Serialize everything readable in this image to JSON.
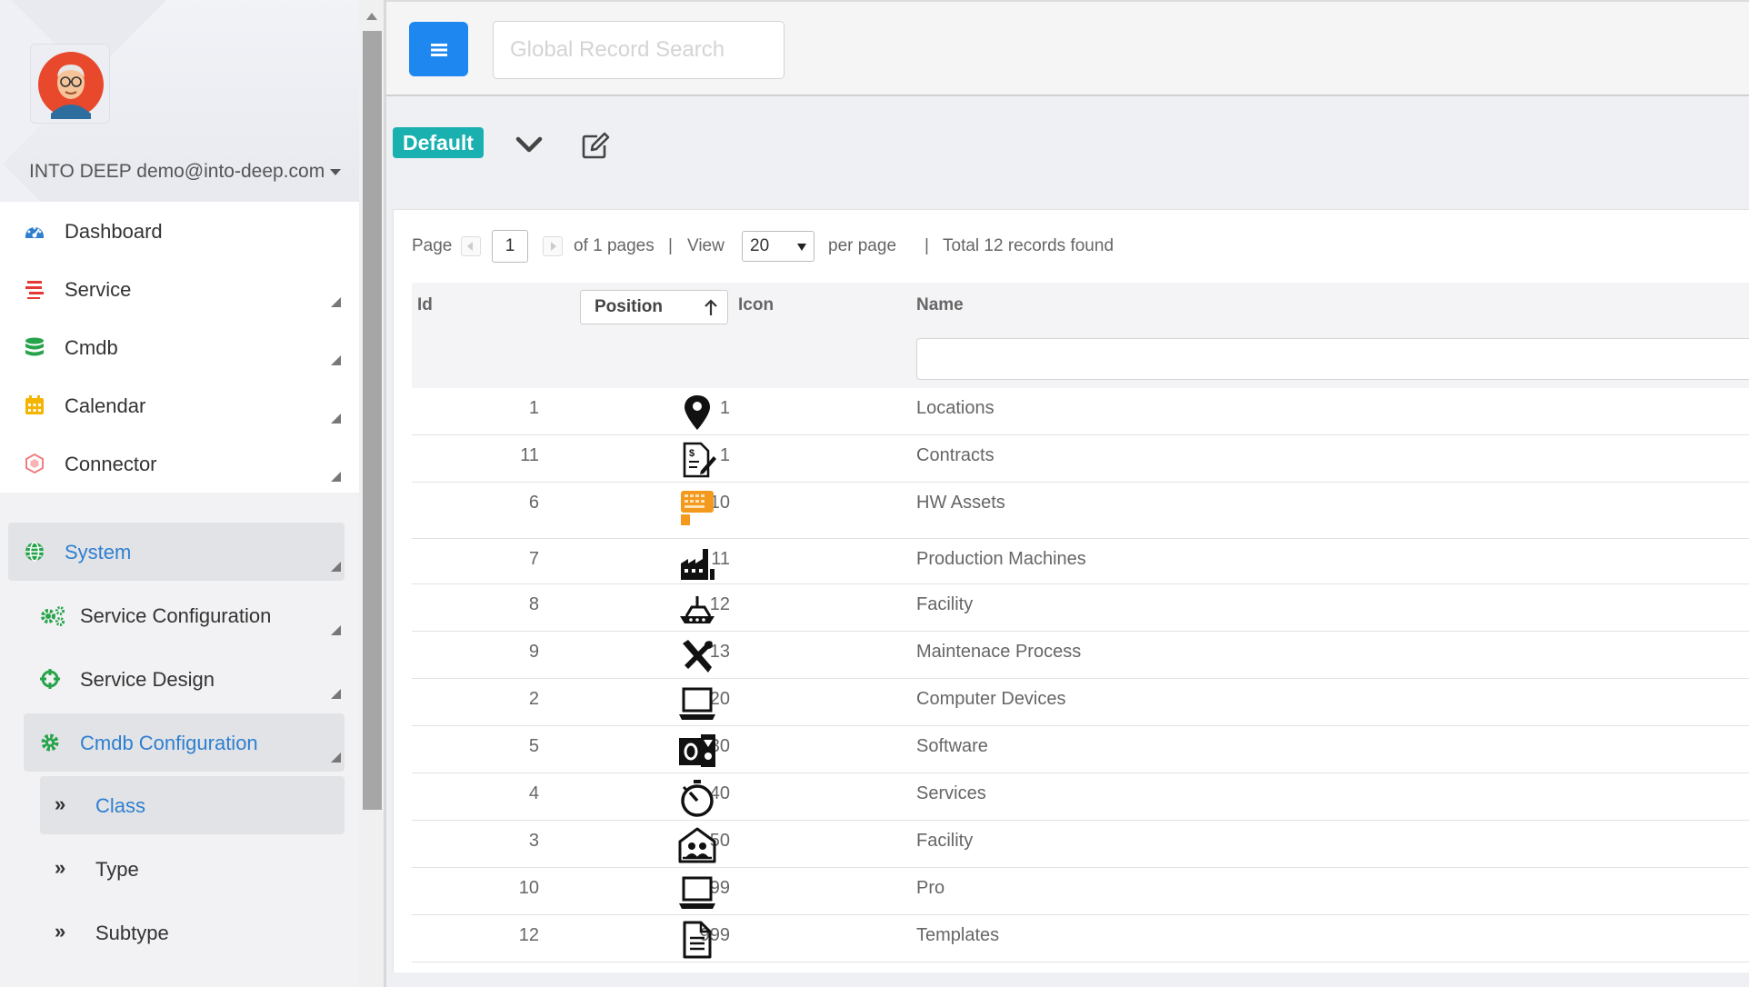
{
  "user": {
    "label": "INTO DEEP demo@into-deep.com"
  },
  "sidebar": {
    "main": [
      {
        "label": "Dashboard",
        "icon": "dashboard-icon",
        "color": "#2e7fd0"
      },
      {
        "label": "Service",
        "icon": "service-list-icon",
        "color": "#e53935"
      },
      {
        "label": "Cmdb",
        "icon": "database-icon",
        "color": "#27a44b"
      },
      {
        "label": "Calendar",
        "icon": "calendar-icon",
        "color": "#f5b400"
      },
      {
        "label": "Connector",
        "icon": "connector-icon",
        "color": "#f08080"
      }
    ],
    "system": {
      "label": "System",
      "icon": "globe-icon"
    },
    "system_items": [
      {
        "label": "Service Configuration",
        "icon": "cogs-icon"
      },
      {
        "label": "Service Design",
        "icon": "crosshair-icon"
      },
      {
        "label": "Cmdb Configuration",
        "icon": "gear-icon"
      }
    ],
    "cmdb_items": [
      {
        "label": "Class"
      },
      {
        "label": "Type"
      },
      {
        "label": "Subtype"
      }
    ]
  },
  "topbar": {
    "search_placeholder": "Global Record Search"
  },
  "view": {
    "name": "Default"
  },
  "pager": {
    "page_label": "Page",
    "page": "1",
    "of_label": "of 1 pages",
    "sep1": "|",
    "view_label": "View",
    "per_page": "20",
    "per_page_label": "per page",
    "sep2": "|",
    "total_label": "Total 12 records found"
  },
  "table": {
    "columns": {
      "id": "Id",
      "position": "Position",
      "icon": "Icon",
      "name": "Name"
    },
    "rows": [
      {
        "id": "1",
        "position": "1",
        "icon": "map-pin-icon",
        "name": "Locations"
      },
      {
        "id": "11",
        "position": "1",
        "icon": "contract-icon",
        "name": "Contracts"
      },
      {
        "id": "6",
        "position": "10",
        "icon": "hw-assets-icon",
        "name": "HW Assets"
      },
      {
        "id": "7",
        "position": "11",
        "icon": "factory-icon",
        "name": "Production Machines"
      },
      {
        "id": "8",
        "position": "12",
        "icon": "facility-ship-icon",
        "name": "Facility"
      },
      {
        "id": "9",
        "position": "13",
        "icon": "tools-icon",
        "name": "Maintenace Process"
      },
      {
        "id": "2",
        "position": "20",
        "icon": "laptop-icon",
        "name": "Computer Devices"
      },
      {
        "id": "5",
        "position": "30",
        "icon": "software-icon",
        "name": "Software"
      },
      {
        "id": "4",
        "position": "40",
        "icon": "stopwatch-icon",
        "name": "Services"
      },
      {
        "id": "3",
        "position": "50",
        "icon": "people-house-icon",
        "name": "Facility"
      },
      {
        "id": "10",
        "position": "99",
        "icon": "laptop-icon",
        "name": "Pro"
      },
      {
        "id": "12",
        "position": "999",
        "icon": "document-icon",
        "name": "Templates"
      }
    ]
  }
}
